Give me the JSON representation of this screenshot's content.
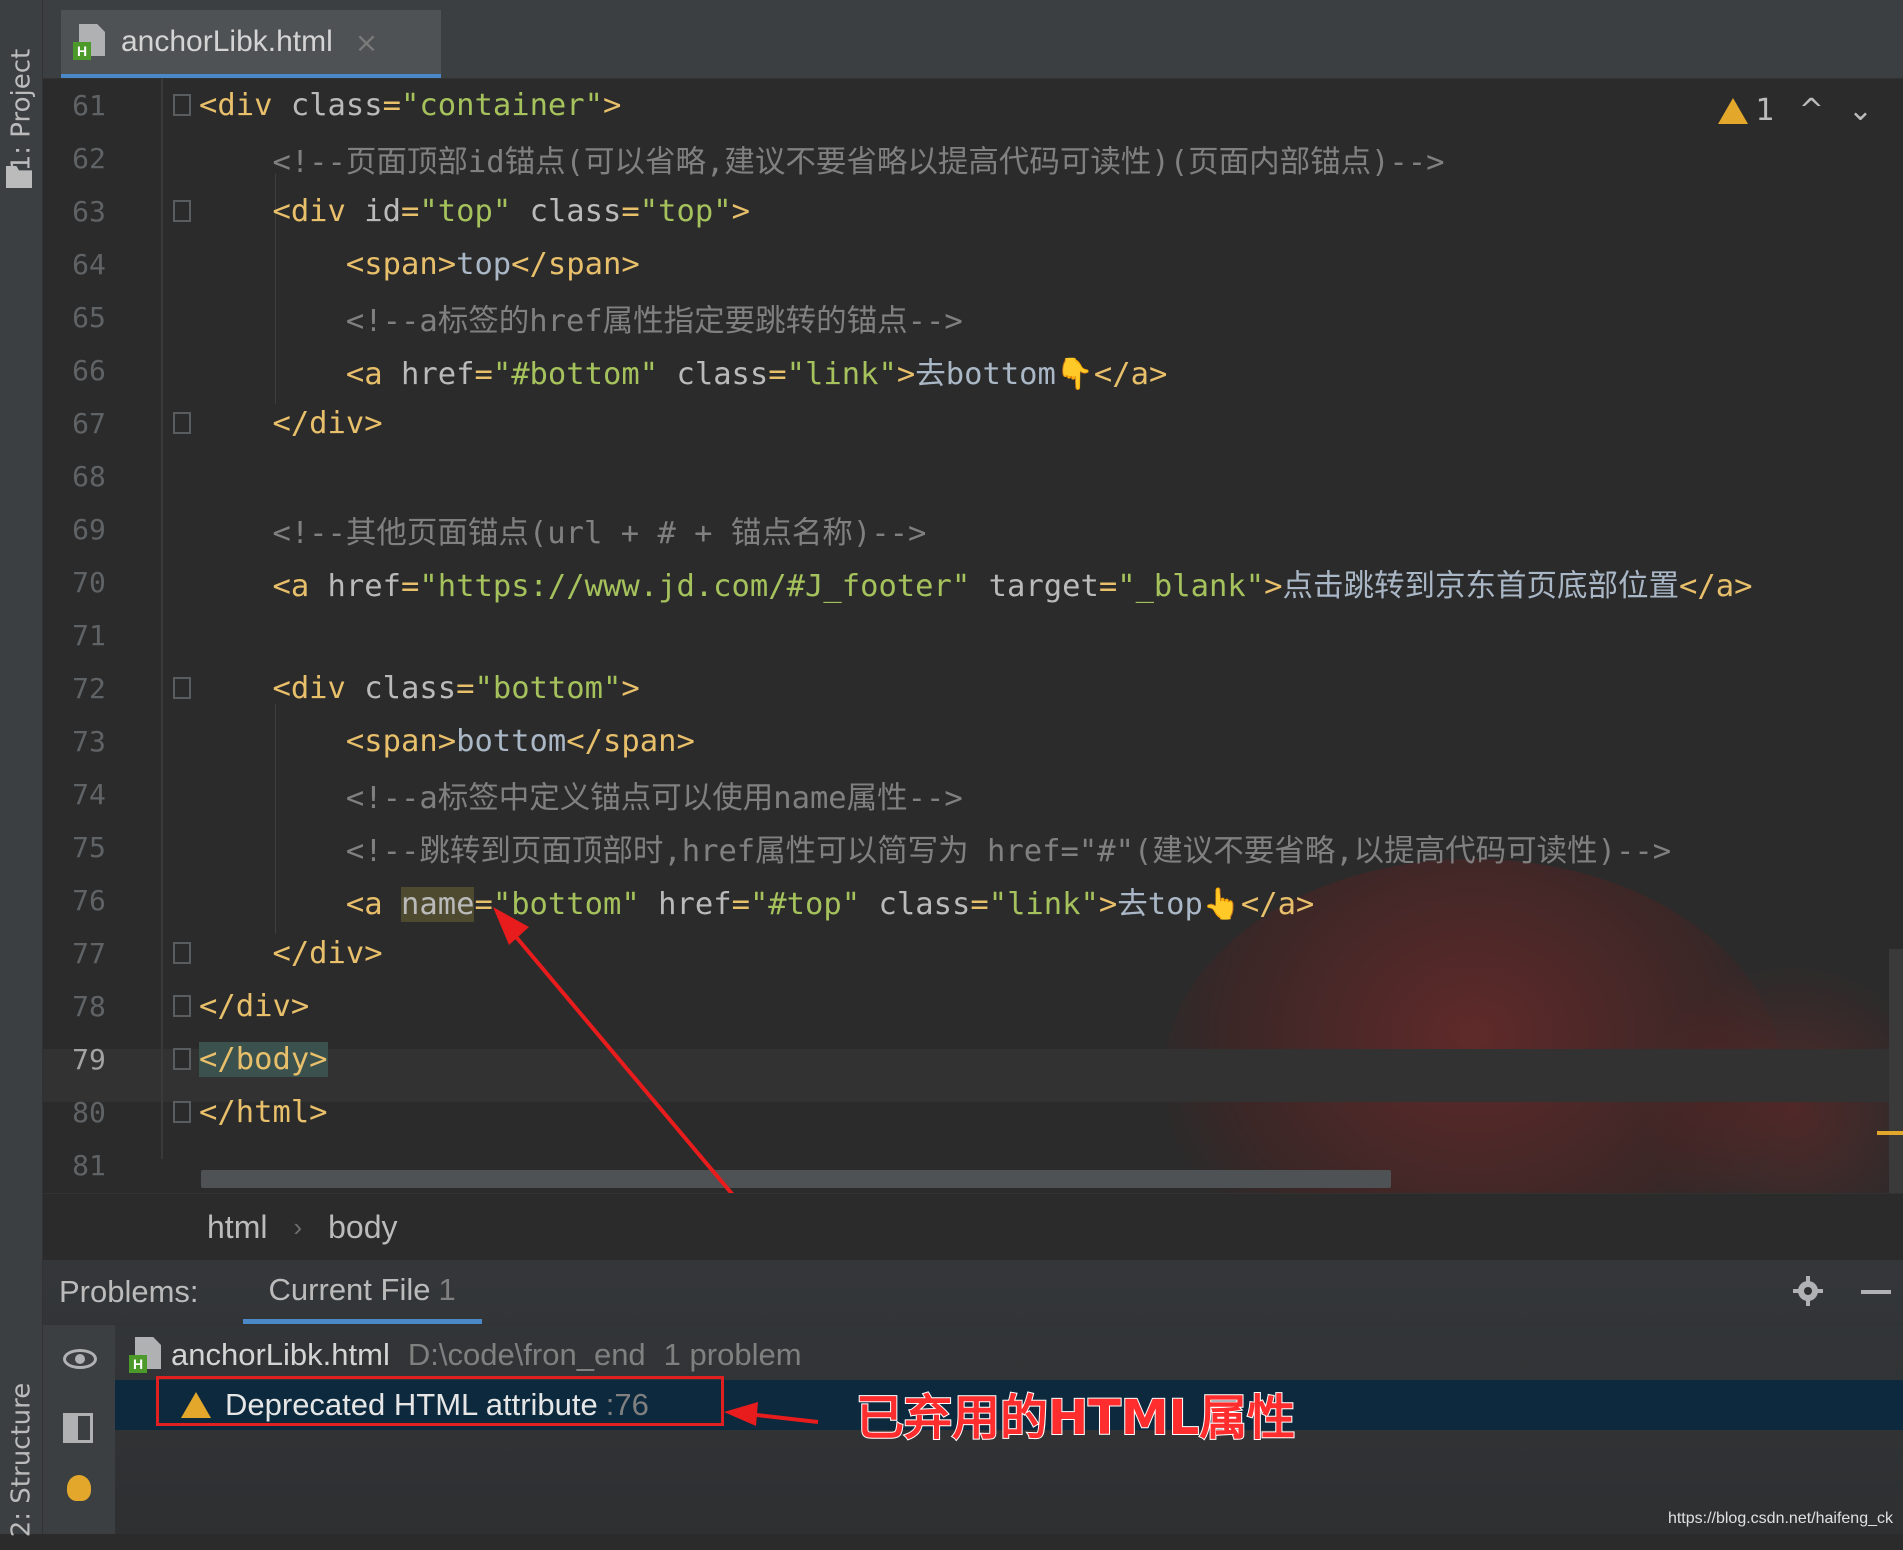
{
  "sidebar": {
    "project_tab": "1: Project",
    "structure_tab": "2: Structure"
  },
  "editor_tab": {
    "filename": "anchorLibk.html",
    "close": "×"
  },
  "warning_indicator": {
    "count": "1",
    "up": "^",
    "down": "⌄"
  },
  "code_lines": [
    {
      "n": "61",
      "parts": [
        [
          "tag",
          "<div "
        ],
        [
          "attr",
          "class"
        ],
        [
          "tag",
          "="
        ],
        [
          "val",
          "\"container\""
        ],
        [
          "tag",
          ">"
        ]
      ]
    },
    {
      "n": "62",
      "parts": [
        [
          "cmt",
          "    <!--页面顶部id锚点(可以省略,建议不要省略以提高代码可读性)(页面内部锚点)-->"
        ]
      ]
    },
    {
      "n": "63",
      "parts": [
        [
          "tag",
          "    <div "
        ],
        [
          "attr",
          "id"
        ],
        [
          "tag",
          "="
        ],
        [
          "val",
          "\"top\""
        ],
        [
          "tag",
          " "
        ],
        [
          "attr",
          "class"
        ],
        [
          "tag",
          "="
        ],
        [
          "val",
          "\"top\""
        ],
        [
          "tag",
          ">"
        ]
      ]
    },
    {
      "n": "64",
      "parts": [
        [
          "tag",
          "        <span>"
        ],
        [
          "txt",
          "top"
        ],
        [
          "tag",
          "</span>"
        ]
      ]
    },
    {
      "n": "65",
      "parts": [
        [
          "cmt",
          "        <!--a标签的href属性指定要跳转的锚点-->"
        ]
      ]
    },
    {
      "n": "66",
      "parts": [
        [
          "tag",
          "        <a "
        ],
        [
          "attr",
          "href"
        ],
        [
          "tag",
          "="
        ],
        [
          "val",
          "\"#bottom\""
        ],
        [
          "tag",
          " "
        ],
        [
          "attr",
          "class"
        ],
        [
          "tag",
          "="
        ],
        [
          "val",
          "\"link\""
        ],
        [
          "tag",
          ">"
        ],
        [
          "txt",
          "去bottom👇"
        ],
        [
          "tag",
          "</a>"
        ]
      ]
    },
    {
      "n": "67",
      "parts": [
        [
          "tag",
          "    </div>"
        ]
      ]
    },
    {
      "n": "68",
      "parts": []
    },
    {
      "n": "69",
      "parts": [
        [
          "cmt",
          "    <!--其他页面锚点(url + # + 锚点名称)-->"
        ]
      ]
    },
    {
      "n": "70",
      "parts": [
        [
          "tag",
          "    <a "
        ],
        [
          "attr",
          "href"
        ],
        [
          "tag",
          "="
        ],
        [
          "val",
          "\"https://www.jd.com/#J_footer\""
        ],
        [
          "tag",
          " "
        ],
        [
          "attr",
          "target"
        ],
        [
          "tag",
          "="
        ],
        [
          "val",
          "\"_blank\""
        ],
        [
          "tag",
          ">"
        ],
        [
          "txt",
          "点击跳转到京东首页底部位置"
        ],
        [
          "tag",
          "</a>"
        ]
      ]
    },
    {
      "n": "71",
      "parts": []
    },
    {
      "n": "72",
      "parts": [
        [
          "tag",
          "    <div "
        ],
        [
          "attr",
          "class"
        ],
        [
          "tag",
          "="
        ],
        [
          "val",
          "\"bottom\""
        ],
        [
          "tag",
          ">"
        ]
      ]
    },
    {
      "n": "73",
      "parts": [
        [
          "tag",
          "        <span>"
        ],
        [
          "txt",
          "bottom"
        ],
        [
          "tag",
          "</span>"
        ]
      ]
    },
    {
      "n": "74",
      "parts": [
        [
          "cmt",
          "        <!--a标签中定义锚点可以使用name属性-->"
        ]
      ]
    },
    {
      "n": "75",
      "parts": [
        [
          "cmt",
          "        <!--跳转到页面顶部时,href属性可以简写为 href=\"#\"(建议不要省略,以提高代码可读性)-->"
        ]
      ]
    },
    {
      "n": "76",
      "parts": [
        [
          "tag",
          "        <a "
        ],
        [
          "attr-hl",
          "name"
        ],
        [
          "tag",
          "="
        ],
        [
          "val",
          "\"bottom\""
        ],
        [
          "tag",
          " "
        ],
        [
          "attr",
          "href"
        ],
        [
          "tag",
          "="
        ],
        [
          "val",
          "\"#top\""
        ],
        [
          "tag",
          " "
        ],
        [
          "attr",
          "class"
        ],
        [
          "tag",
          "="
        ],
        [
          "val",
          "\"link\""
        ],
        [
          "tag",
          ">"
        ],
        [
          "txt",
          "去top👆"
        ],
        [
          "tag",
          "</a>"
        ]
      ]
    },
    {
      "n": "77",
      "parts": [
        [
          "tag",
          "    </div>"
        ]
      ]
    },
    {
      "n": "78",
      "parts": [
        [
          "tag",
          "</div>"
        ]
      ]
    },
    {
      "n": "79",
      "parts": [
        [
          "tag-hl",
          "</body>"
        ]
      ]
    },
    {
      "n": "80",
      "parts": [
        [
          "tag",
          "</html>"
        ]
      ]
    },
    {
      "n": "81",
      "parts": []
    }
  ],
  "breadcrumb": {
    "first": "html",
    "separator": "›",
    "second": "body"
  },
  "problems": {
    "title": "Problems:",
    "tab_label": "Current File",
    "tab_count": "1",
    "file_name": "anchorLibk.html",
    "file_path": "D:\\code\\fron_end",
    "file_problems": "1 problem",
    "issue_text": "Deprecated HTML attribute",
    "issue_line": ":76"
  },
  "annotation": {
    "label": "已弃用的HTML属性"
  },
  "watermark": "https://blog.csdn.net/haifeng_ck",
  "colors": {
    "warning": "#e2a72b",
    "annotation": "#ff2d2d",
    "selection": "#0d293e"
  }
}
